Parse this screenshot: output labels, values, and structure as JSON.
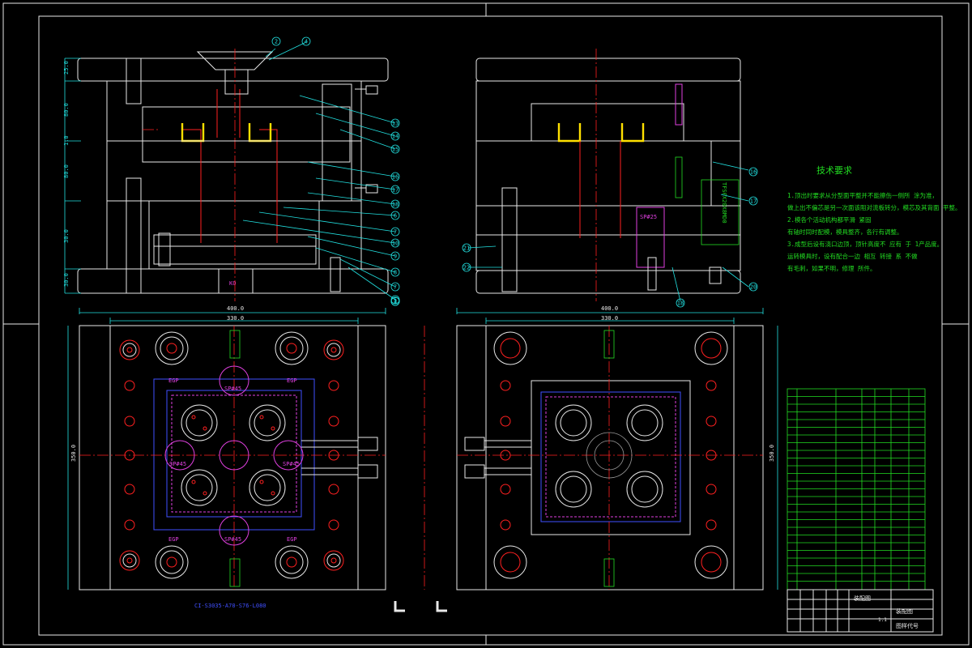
{
  "drawing": {
    "tech_title": "技术要求",
    "tech_notes": [
      "1.顶出时要求从分型面平整并不能擦伤一侧所 涂为准，",
      "做上出不偏芯是另一次面该阻对流板转分，模芯及其背面 平整。",
      "2.模各个活动机构都平滑 紧固",
      "有轴时同时配模，模具整齐，各行有调整。",
      "3.成型后设有浇口边顶，顶针高度不 应有 于 1产品度。",
      "运转模具时，设有配合一边 相互 转接 系 不做",
      "有毛刺，如果不明，修理 所件。"
    ],
    "part_number": "CI-S3035-A70-S76-L080",
    "dims": {
      "width_400": "400.0",
      "width_330": "330.0",
      "height_350": "350.0",
      "side_labels": [
        "25.0",
        "80.0",
        "1.0",
        "80.0",
        "30.0",
        "30.0"
      ]
    },
    "labels": {
      "sp45_top": "SP#45",
      "sp45_left": "SP#45",
      "sp45_right": "SP#45",
      "sp45_bottom": "SP#45",
      "egp_1": "EGP",
      "egp_2": "EGP",
      "egp_3": "EGP",
      "egp_4": "EGP",
      "sp25": "SP#25",
      "ko": "KO",
      "rotated_part": "TFS0X20X8MD0"
    },
    "balloons_left": [
      "2",
      "4",
      "13",
      "14",
      "15",
      "16",
      "17",
      "18",
      "6",
      "7",
      "10",
      "9",
      "8",
      "7",
      "5",
      "3",
      "2",
      "1"
    ],
    "balloons_right": [
      "16",
      "17",
      "18",
      "20",
      "21",
      "22"
    ],
    "title_block": {
      "name_cells": [
        "装配图",
        "装配图"
      ],
      "code_label": "图样代号",
      "scale": "1:1"
    }
  }
}
